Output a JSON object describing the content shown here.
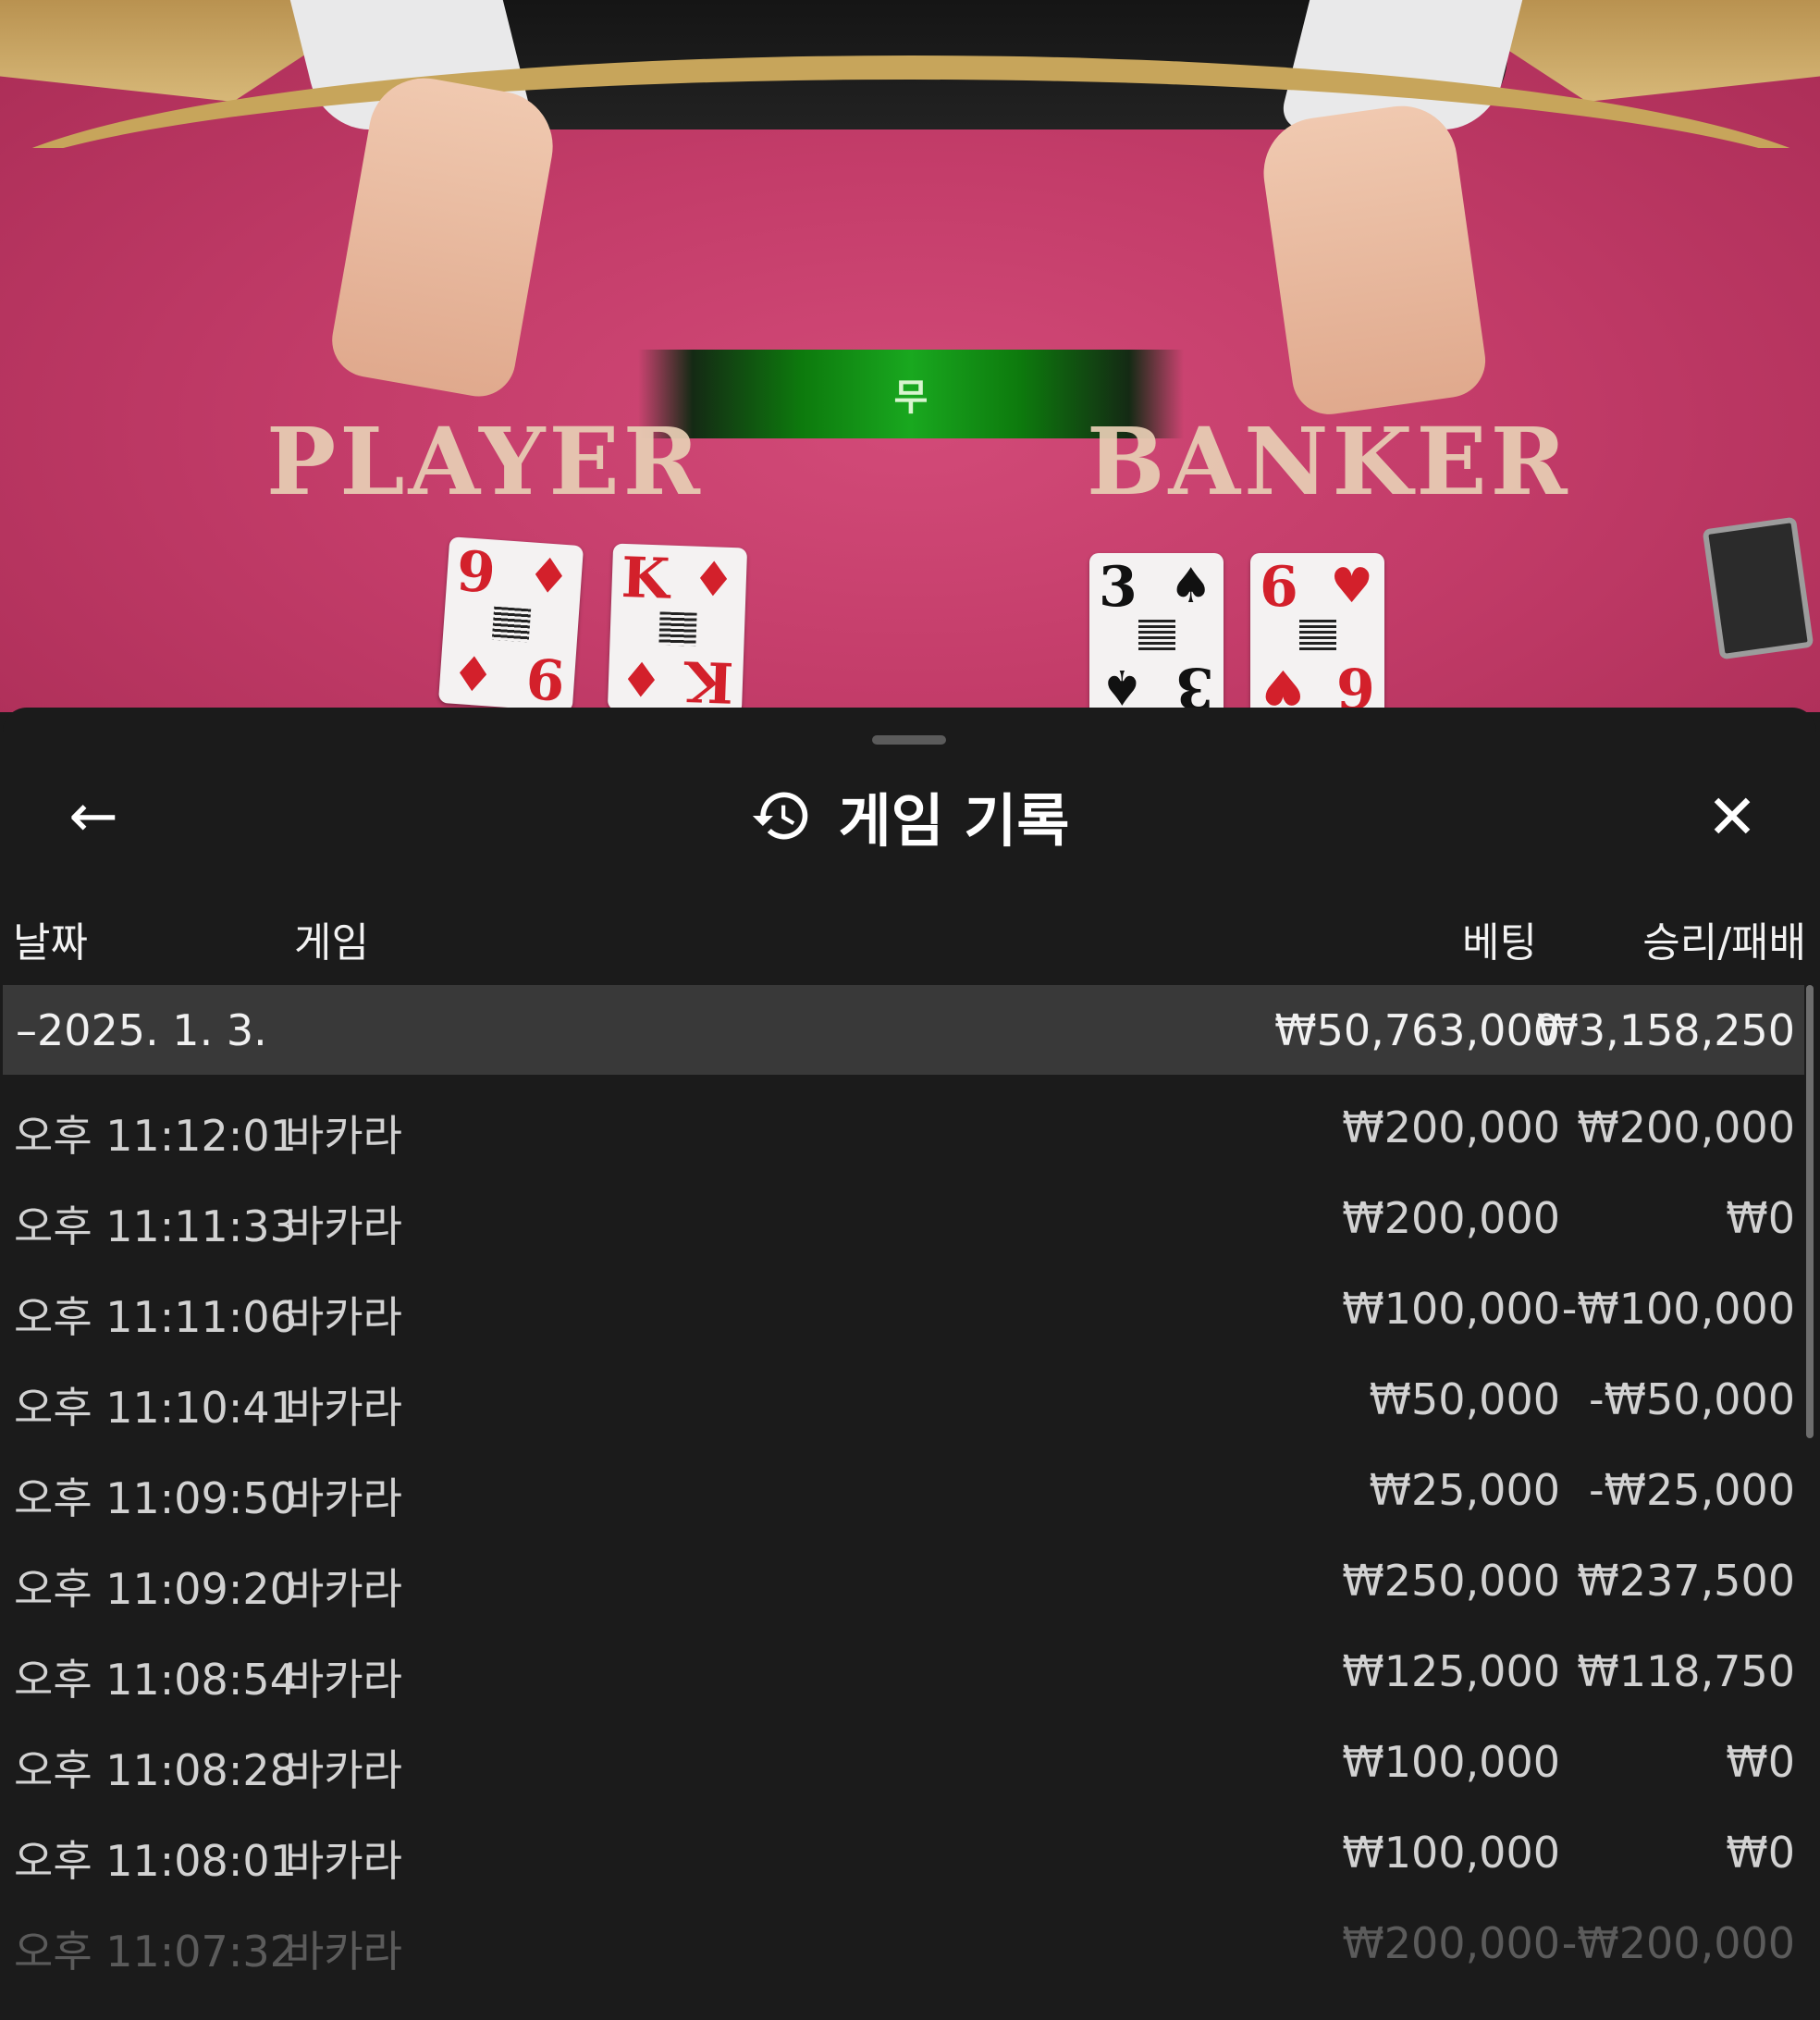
{
  "table": {
    "result_label": "무",
    "player_label": "PLAYER",
    "banker_label": "BANKER",
    "player_cards": [
      {
        "rank": "9",
        "suit": "♦",
        "color": "red"
      },
      {
        "rank": "K",
        "suit": "♦",
        "color": "red"
      }
    ],
    "banker_cards": [
      {
        "rank": "3",
        "suit": "♠",
        "color": "black"
      },
      {
        "rank": "6",
        "suit": "♥",
        "color": "red"
      }
    ],
    "result_color": "#19a81f"
  },
  "panel": {
    "back_icon": "←",
    "close_icon": "✕",
    "title": "게임 기록",
    "title_icon": "history-icon",
    "columns": {
      "date": "날짜",
      "game": "게임",
      "bet": "베팅",
      "win_loss": "승리/패배"
    },
    "date_group": {
      "date": "–2025. 1. 3.",
      "bet_total": "₩50,763,000",
      "win_total": "₩3,158,250"
    },
    "rows": [
      {
        "time": "오후 11:12:01",
        "game": "바카라",
        "bet": "₩200,000",
        "win": "₩200,000"
      },
      {
        "time": "오후 11:11:33",
        "game": "바카라",
        "bet": "₩200,000",
        "win": "₩0"
      },
      {
        "time": "오후 11:11:06",
        "game": "바카라",
        "bet": "₩100,000",
        "win": "-₩100,000"
      },
      {
        "time": "오후 11:10:41",
        "game": "바카라",
        "bet": "₩50,000",
        "win": "-₩50,000"
      },
      {
        "time": "오후 11:09:50",
        "game": "바카라",
        "bet": "₩25,000",
        "win": "-₩25,000"
      },
      {
        "time": "오후 11:09:20",
        "game": "바카라",
        "bet": "₩250,000",
        "win": "₩237,500"
      },
      {
        "time": "오후 11:08:54",
        "game": "바카라",
        "bet": "₩125,000",
        "win": "₩118,750"
      },
      {
        "time": "오후 11:08:28",
        "game": "바카라",
        "bet": "₩100,000",
        "win": "₩0"
      },
      {
        "time": "오후 11:08:01",
        "game": "바카라",
        "bet": "₩100,000",
        "win": "₩0"
      },
      {
        "time": "오후 11:07:32",
        "game": "바카라",
        "bet": "₩200,000",
        "win": "-₩200,000"
      }
    ]
  }
}
